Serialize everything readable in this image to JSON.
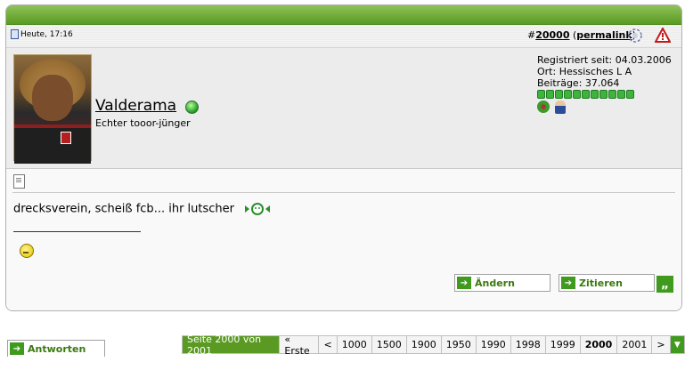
{
  "post": {
    "date": "Heute, 17:16",
    "number_prefix": "#",
    "number": "20000",
    "permalink": "permalink",
    "user": {
      "name": "Valderama",
      "title": "Echter tooor-jünger",
      "registered": "Registriert seit: 04.03.2006",
      "location": "Ort: Hessisches L A",
      "posts": "Beiträge: 37.064"
    },
    "message": "drecksverein, scheiß fcb... ihr lutscher",
    "buttons": {
      "edit": "Ändern",
      "quote": "Zitieren",
      "quote_icon": "„"
    }
  },
  "reply_button": "Antworten",
  "pager": {
    "label": "Seite 2000 von 2001",
    "first": "« Erste",
    "prev": "<",
    "pages": [
      "1000",
      "1500",
      "1900",
      "1950",
      "1990",
      "1998",
      "1999",
      "2000",
      "2001"
    ],
    "current": "2000",
    "next": ">"
  },
  "colors": {
    "accent": "#5a9a22",
    "button_text": "#3b7a10"
  }
}
